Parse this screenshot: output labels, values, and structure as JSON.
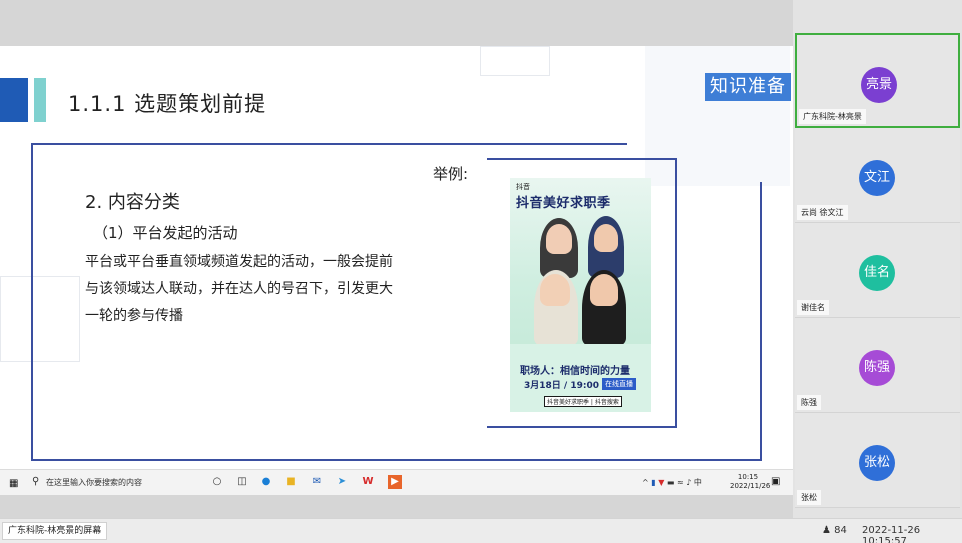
{
  "slide": {
    "title": "1.1.1 选题策划前提",
    "badge": "知识准备",
    "example_label": "举例:",
    "section_heading": "2. 内容分类",
    "sub_heading": "（1）平台发起的活动",
    "body_lines": [
      "平台或平台垂直领域频道发起的活动，一般会提前",
      "与该领域达人联动，并在达人的号召下，引发更大",
      "一轮的参与传播"
    ],
    "poster": {
      "brand": "抖音",
      "headline": "抖音美好求职季",
      "tagline": "职场人：相信时间的力量",
      "date": "3月18日 / 19:00",
      "live": "在线直播",
      "search": "抖音美好求职季 | 抖音搜索"
    },
    "accent_colors": [
      "#1f5bb5",
      "#3a4fa0",
      "#3e7ed6",
      "#7fd1cf"
    ]
  },
  "taskbar": {
    "start_icon": "windows-icon",
    "search_placeholder": "在这里输入你要搜索的内容",
    "tray_ime": "中",
    "clock_time": "10:15",
    "clock_date": "2022/11/26"
  },
  "participants": [
    {
      "avatar_text": "亮景",
      "name": "广东科院-林亮景",
      "color": "#7b3fd1",
      "active": true
    },
    {
      "avatar_text": "文江",
      "name": "云尚 徐文江",
      "color": "#2f6fd8",
      "active": false
    },
    {
      "avatar_text": "佳名",
      "name": "谢佳名",
      "color": "#1fbf9f",
      "active": false
    },
    {
      "avatar_text": "陈强",
      "name": "陈强",
      "color": "#a64bd6",
      "active": false
    },
    {
      "avatar_text": "张松",
      "name": "张松",
      "color": "#2f6fd8",
      "active": false
    }
  ],
  "bottom": {
    "screen_owner": "广东科院-林亮景的屏幕",
    "attendee_count": "84",
    "datetime": "2022-11-26 10:15:57"
  }
}
